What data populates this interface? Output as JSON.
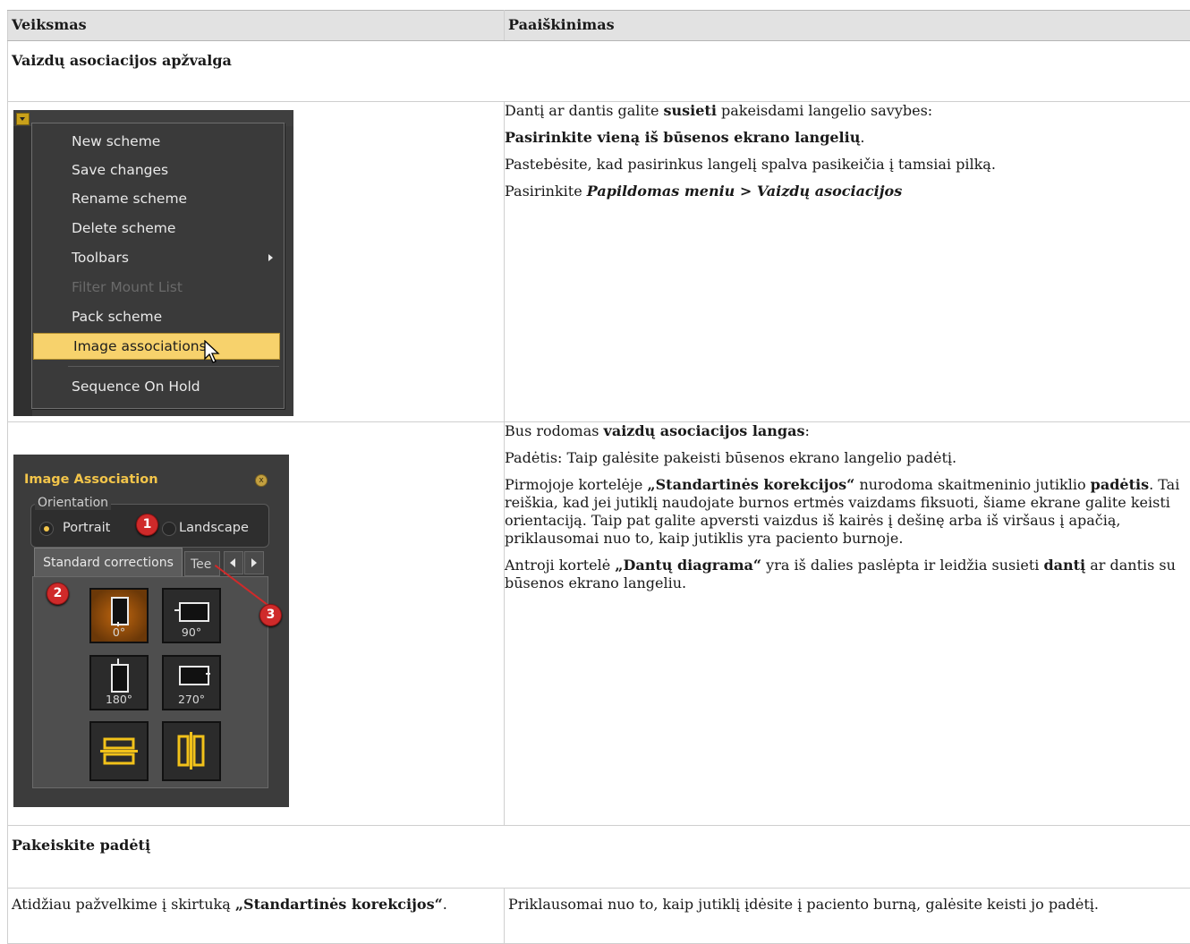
{
  "table": {
    "header": {
      "col1": "Veiksmas",
      "col2": "Paaiškinimas"
    },
    "section1": "Vaizdų asociacijos apžvalga",
    "section2": "Pakeiskite padėtį"
  },
  "row1": {
    "menu": {
      "items": [
        {
          "label": "New scheme"
        },
        {
          "label": "Save changes"
        },
        {
          "label": "Rename scheme"
        },
        {
          "label": "Delete scheme"
        },
        {
          "label": "Toolbars"
        },
        {
          "label": "Filter Mount List"
        },
        {
          "label": "Pack scheme"
        },
        {
          "label": "Image associations"
        },
        {
          "label": "Sequence On Hold"
        }
      ]
    },
    "text": {
      "p1_a": "Dantį ar dantis galite ",
      "p1_b": "susieti",
      "p1_c": " pakeisdami langelio savybes:",
      "p2": "Pasirinkite vieną iš būsenos ekrano langelių",
      "p2_end": ".",
      "p3": "Pastebėsite, kad pasirinkus langelį spalva pasikeičia į tamsiai pilką.",
      "p4_a": "Pasirinkite ",
      "p4_b": "Papildomas meniu > Vaizdų asociacijos"
    }
  },
  "row2": {
    "panel": {
      "title": "Image Association",
      "close": "x",
      "orientation_label": "Orientation",
      "radio_portrait": "Portrait",
      "radio_landscape": "Landscape",
      "tab_standard": "Standard corrections",
      "tab_teeth": "Tee",
      "rotations": [
        "0°",
        "90°",
        "180°",
        "270°"
      ],
      "badges": [
        "1",
        "2",
        "3"
      ]
    },
    "text": {
      "p1_a": "Bus rodomas ",
      "p1_b": "vaizdų asociacijos langas",
      "p1_c": ":",
      "p2": " Padėtis: Taip galėsite pakeisti būsenos ekrano langelio padėtį.",
      "p3_a": " Pirmojoje kortelėje ",
      "p3_b": "„Standartinės korekcijos“",
      "p3_c": " nurodoma skaitmeninio jutiklio ",
      "p3_d": "padėtis",
      "p3_e": ".  Tai reiškia, kad jei jutiklį naudojate burnos ertmės vaizdams fiksuoti, šiame ekrane galite keisti orientaciją. Taip pat galite apversti vaizdus iš kairės į dešinę arba iš viršaus į apačią, priklausomai nuo to, kaip jutiklis yra paciento burnoje.",
      "p4_a": " Antroji kortelė ",
      "p4_b": "„Dantų diagrama“",
      "p4_c": " yra iš dalies paslėpta ir leidžia susieti ",
      "p4_d": "dantį",
      "p4_e": " ar dantis su būsenos ekrano langeliu."
    }
  },
  "row3": {
    "left_a": "Atidžiau pažvelkime į skirtuką ",
    "left_b": "„Standartinės korekcijos“",
    "left_c": ".",
    "right": "Priklausomai nuo to, kaip jutiklį įdėsite į paciento burną, galėsite keisti jo padėtį."
  }
}
